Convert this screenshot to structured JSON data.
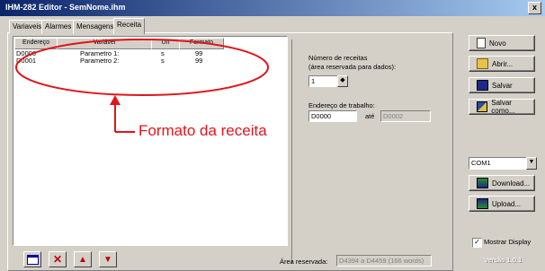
{
  "window": {
    "title": "IHM-282 Editor - SemNome.ihm",
    "close_label": "x"
  },
  "tabs": [
    {
      "label": "Variaveis"
    },
    {
      "label": "Alarmes"
    },
    {
      "label": "Mensagens"
    },
    {
      "label": "Receita"
    }
  ],
  "table": {
    "columns": [
      "Endereço",
      "Variável",
      "Un",
      "Formato"
    ],
    "rows": [
      [
        "D0000",
        "Parametro 1:",
        "s",
        "99"
      ],
      [
        "D0001",
        "Parametro 2:",
        "s",
        "99"
      ]
    ]
  },
  "recipes": {
    "count_label_1": "Número de receitas",
    "count_label_2": "(área reservada para dados):",
    "count_value": "1",
    "address_label": "Endereço de trabalho:",
    "address_value": "D0000",
    "ate_label": "até",
    "address_end": "D0002",
    "reserved_label": "Área reservada:",
    "reserved_value": "D4394 a D4459 (166 words)"
  },
  "annotation": "Formato da receita",
  "buttons": {
    "novo": "Novo",
    "abrir": "Abrir...",
    "salvar": "Salvar",
    "salvar_como": "Salvar como...",
    "download": "Download...",
    "upload": "Upload..."
  },
  "port": {
    "selected": "COM1"
  },
  "show_display": {
    "label": "Mostrar Display",
    "checked": true
  },
  "version": "Versão 1.0.1",
  "colors": {
    "annotation": "#e0151b",
    "titlebar": "#0a246a"
  }
}
